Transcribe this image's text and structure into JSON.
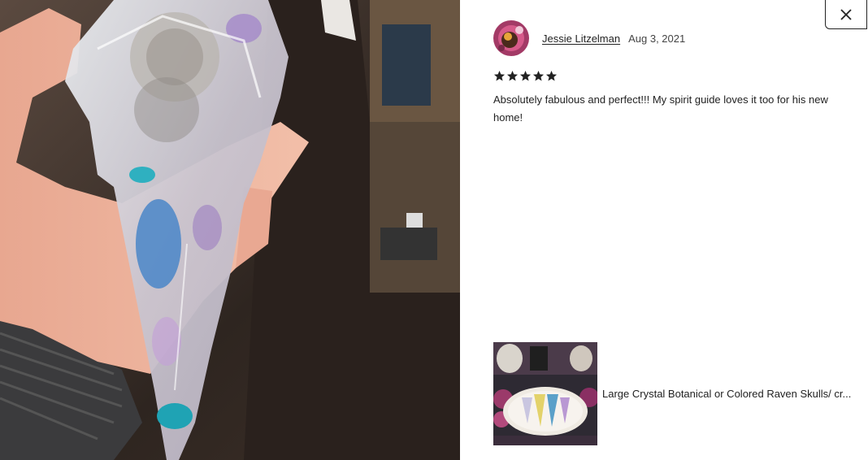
{
  "review": {
    "reviewer_name": "Jessie Litzelman",
    "date": "Aug 3, 2021",
    "rating": 5,
    "text": "Absolutely fabulous and perfect!!! My spirit guide loves it too for his new home!"
  },
  "listing": {
    "title": "Large Crystal Botanical or Colored Raven Skulls/ cr..."
  },
  "icons": {
    "close": "close-icon",
    "star": "star-icon"
  },
  "colors": {
    "text": "#222222",
    "star": "#222222",
    "close_border": "#222222"
  }
}
